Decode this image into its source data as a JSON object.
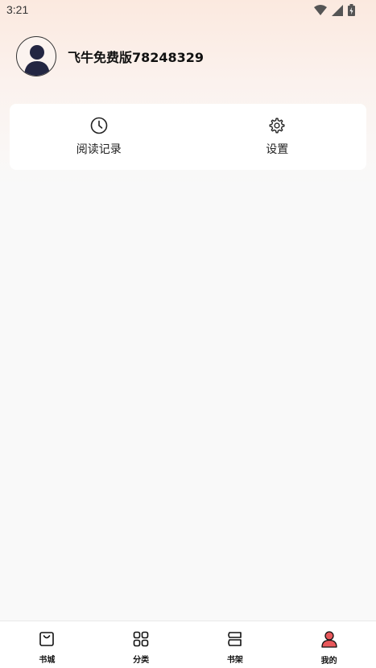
{
  "status_bar": {
    "time": "3:21"
  },
  "profile": {
    "username": "飞牛免费版78248329"
  },
  "quick_actions": [
    {
      "label": "阅读记录",
      "icon": "clock-icon"
    },
    {
      "label": "设置",
      "icon": "gear-icon"
    }
  ],
  "tabbar": {
    "items": [
      {
        "label": "书城",
        "icon": "shopping-bag-icon"
      },
      {
        "label": "分类",
        "icon": "grid-icon"
      },
      {
        "label": "书架",
        "icon": "bookshelf-icon"
      },
      {
        "label": "我的",
        "icon": "user-icon",
        "active": true
      }
    ]
  },
  "colors": {
    "accent": "#e8585b",
    "background": "#f9f9f9",
    "gradient_top": "#fbe9df"
  }
}
